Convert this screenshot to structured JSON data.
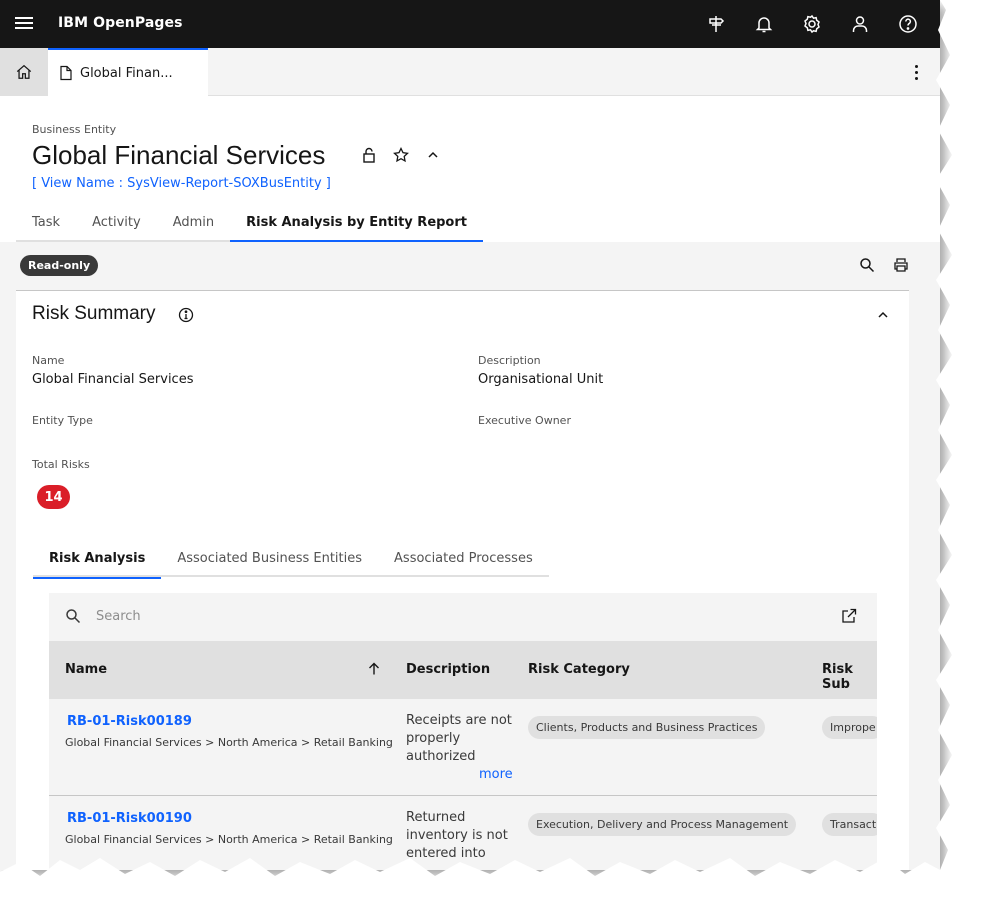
{
  "app": {
    "title": "IBM OpenPages"
  },
  "tabs": {
    "document_tab_label": "Global Finan..."
  },
  "header": {
    "entity_type": "Business Entity",
    "title": "Global Financial Services",
    "view_name": "[ View Name : SysView-Report-SOXBusEntity ]"
  },
  "main_tabs": [
    {
      "label": "Task"
    },
    {
      "label": "Activity"
    },
    {
      "label": "Admin"
    },
    {
      "label": "Risk Analysis by Entity Report",
      "active": true
    }
  ],
  "content": {
    "readonly_badge": "Read-only",
    "panel_title": "Risk Summary",
    "fields": {
      "name_label": "Name",
      "name_value": "Global Financial Services",
      "description_label": "Description",
      "description_value": "Organisational Unit",
      "entity_type_label": "Entity Type",
      "executive_owner_label": "Executive Owner",
      "total_risks_label": "Total Risks",
      "total_risks_value": "14"
    },
    "sub_tabs": [
      {
        "label": "Risk Analysis",
        "active": true
      },
      {
        "label": "Associated Business Entities"
      },
      {
        "label": "Associated Processes"
      }
    ]
  },
  "table": {
    "search_placeholder": "Search",
    "columns": [
      "Name",
      "Description",
      "Risk Category",
      "Risk Sub"
    ],
    "rows": [
      {
        "name": "RB-01-Risk00189",
        "path": "Global Financial Services > North America > Retail Banking",
        "description": "Receipts are not properly authorized",
        "more": "more",
        "risk_category": "Clients, Products and Business Practices",
        "risk_sub": "Imprope"
      },
      {
        "name": "RB-01-Risk00190",
        "path": "Global Financial Services > North America > Retail Banking",
        "description": "Returned inventory is not entered into",
        "risk_category": "Execution, Delivery and Process Management",
        "risk_sub": "Transact"
      }
    ]
  },
  "colors": {
    "accent": "#0f62fe",
    "topbar": "#161616",
    "badge_red": "#da1e28"
  }
}
